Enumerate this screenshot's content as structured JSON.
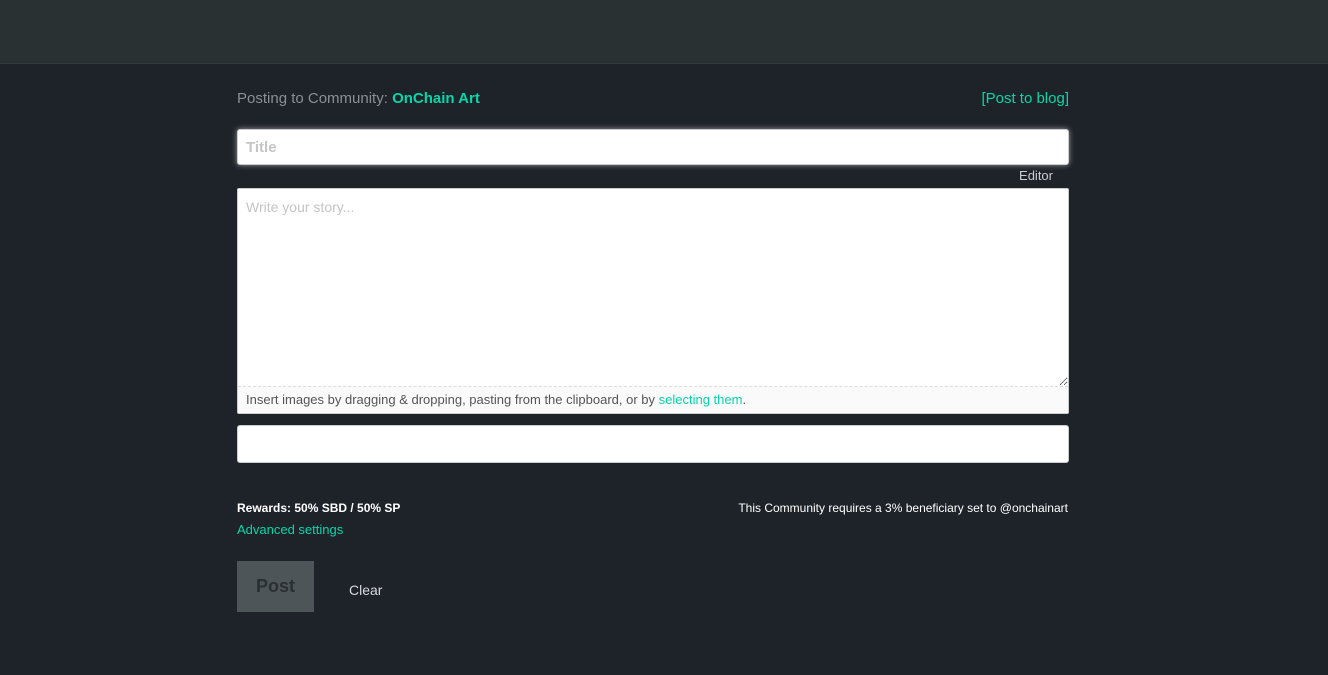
{
  "community": {
    "label": "Posting to Community:",
    "name": "OnChain Art",
    "post_to_blog": "[Post to blog]"
  },
  "editor": {
    "title_placeholder": "Title",
    "editor_toggle": "Editor",
    "body_placeholder": "Write your story...",
    "dropzone_text": "Insert images by dragging & dropping, pasting from the clipboard, or by ",
    "dropzone_link": "selecting them",
    "dropzone_suffix": ".",
    "tags_value": ""
  },
  "footer": {
    "rewards": "Rewards: 50% SBD / 50% SP",
    "advanced_settings": "Advanced settings",
    "beneficiary_note": "This Community requires a 3% beneficiary set to @onchainart",
    "post_label": "Post",
    "clear_label": "Clear"
  },
  "colors": {
    "background": "#1e2329",
    "topbar": "#293133",
    "accent": "#06d6a9",
    "post_button": "#4e5559"
  }
}
